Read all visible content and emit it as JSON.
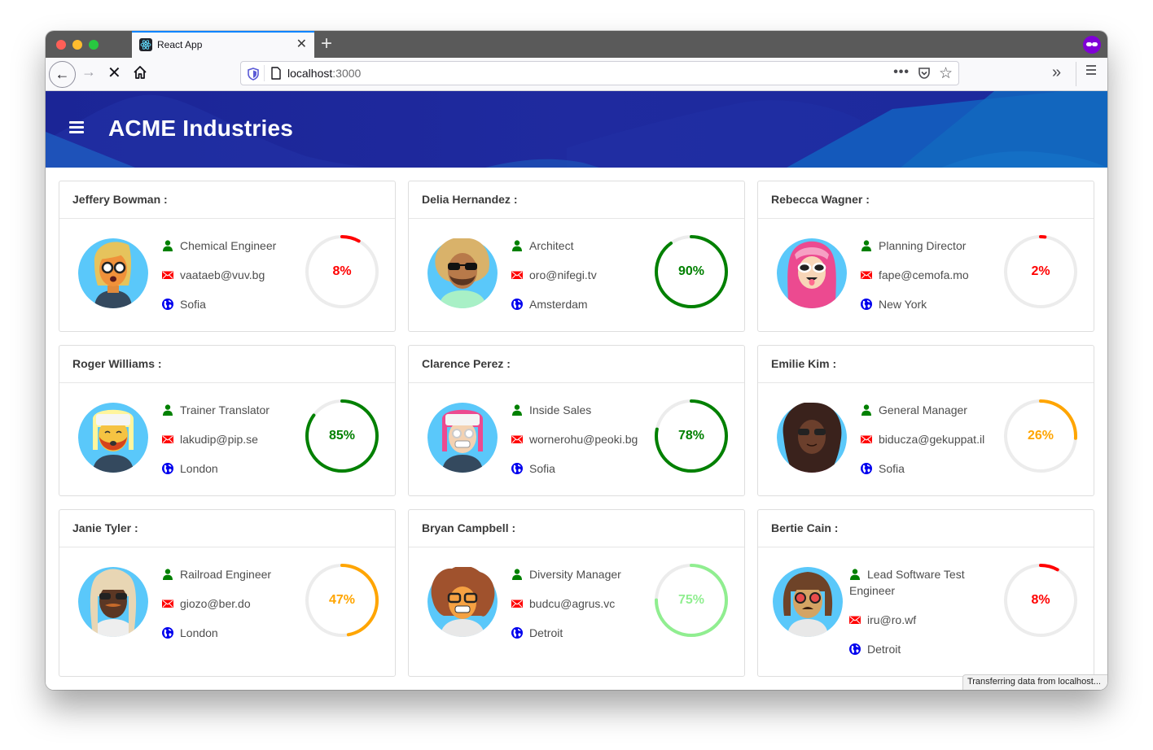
{
  "browser": {
    "tab_title": "React App",
    "url_host": "localhost",
    "url_port": ":3000",
    "status_text": "Transferring data from localhost..."
  },
  "app": {
    "title": "ACME Industries",
    "colors": {
      "header": "#1c2799",
      "good": "#008000",
      "light_good": "#90ee90",
      "warn": "#ffa500",
      "bad": "#ff0000",
      "track": "#ececec"
    }
  },
  "employees": [
    {
      "name": "Jeffery Bowman :",
      "title": "Chemical Engineer",
      "email": "vaataeb@vuv.bg",
      "city": "Sofia",
      "progress": 8,
      "progress_label": "8%",
      "color": "#ff0000",
      "avatar": "blonde-glasses"
    },
    {
      "name": "Delia Hernandez :",
      "title": "Architect",
      "email": "oro@nifegi.tv",
      "city": "Amsterdam",
      "progress": 90,
      "progress_label": "90%",
      "color": "#008000",
      "avatar": "curly-sunglasses-beard"
    },
    {
      "name": "Rebecca Wagner :",
      "title": "Planning Director",
      "email": "fape@cemofa.mo",
      "city": "New York",
      "progress": 2,
      "progress_label": "2%",
      "color": "#ff0000",
      "avatar": "pink-hijab"
    },
    {
      "name": "Roger Williams :",
      "title": "Trainer Translator",
      "email": "lakudip@pip.se",
      "city": "London",
      "progress": 85,
      "progress_label": "85%",
      "color": "#008000",
      "avatar": "hat-red-beard"
    },
    {
      "name": "Clarence Perez :",
      "title": "Inside Sales",
      "email": "wornerohu@peoki.bg",
      "city": "Sofia",
      "progress": 78,
      "progress_label": "78%",
      "color": "#008000",
      "avatar": "pink-hat-glasses"
    },
    {
      "name": "Emilie Kim :",
      "title": "General Manager",
      "email": "biducza@gekuppat.il",
      "city": "Sofia",
      "progress": 26,
      "progress_label": "26%",
      "color": "#ffa500",
      "avatar": "dreadlocks-sunglasses"
    },
    {
      "name": "Janie Tyler :",
      "title": "Railroad Engineer",
      "email": "giozo@ber.do",
      "city": "London",
      "progress": 47,
      "progress_label": "47%",
      "color": "#ffa500",
      "avatar": "long-hair-sunglasses"
    },
    {
      "name": "Bryan Campbell :",
      "title": "Diversity Manager",
      "email": "budcu@agrus.vc",
      "city": "Detroit",
      "progress": 75,
      "progress_label": "75%",
      "color": "#90ee90",
      "avatar": "curly-glasses-wink"
    },
    {
      "name": "Bertie Cain :",
      "title": "Lead Software Test Engineer",
      "email": "iru@ro.wf",
      "city": "Detroit",
      "progress": 8,
      "progress_label": "8%",
      "color": "#ff0000",
      "avatar": "heart-glasses"
    }
  ],
  "icons": {
    "title": "person-icon",
    "email": "envelope-icon",
    "city": "globe-icon"
  }
}
